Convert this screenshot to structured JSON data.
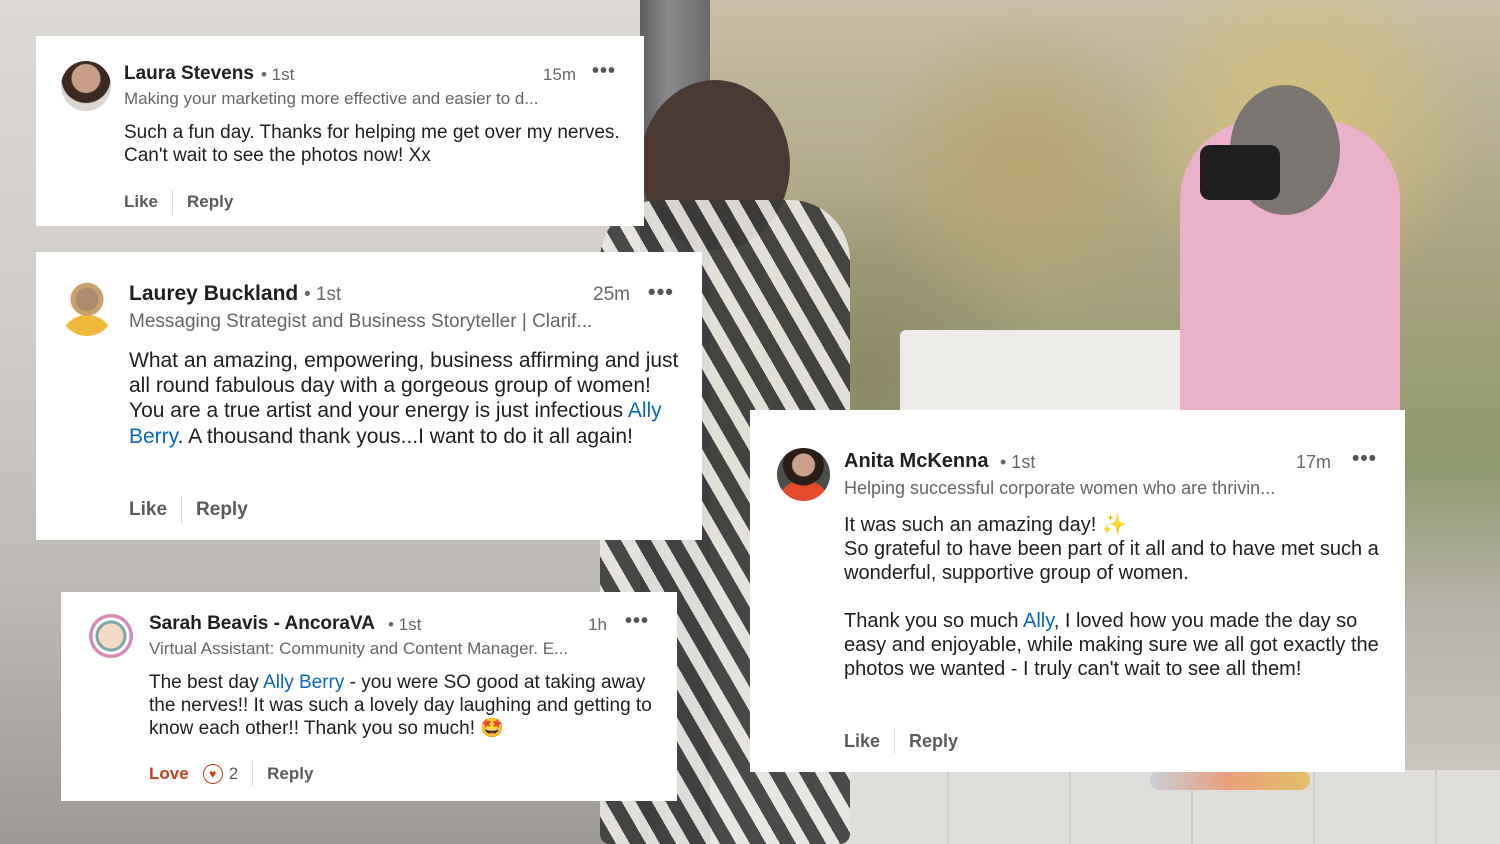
{
  "comments": [
    {
      "name": "Laura Stevens",
      "degree": "• 1st",
      "time": "15m",
      "more": "•••",
      "headline": "Making your marketing more effective and easier to d...",
      "body_parts": [
        "Such a fun day. Thanks for helping me get over my nerves. Can't wait to see the photos now! Xx"
      ],
      "like_label": "Like",
      "reply_label": "Reply"
    },
    {
      "name": "Laurey Buckland",
      "degree": "• 1st",
      "time": "25m",
      "more": "•••",
      "headline": "Messaging Strategist and Business Storyteller | Clarif...",
      "body_before": "What an amazing, empowering, business affirming and just all round fabulous day with a gorgeous group of women! You are a true artist and your energy is just infectious ",
      "mention": "Ally Berry",
      "body_after": ". A thousand thank yous...I want to do it all again!",
      "like_label": "Like",
      "reply_label": "Reply"
    },
    {
      "name": "Sarah Beavis - AncoraVA",
      "degree": "• 1st",
      "time": "1h",
      "more": "•••",
      "headline": "Virtual Assistant: Community and Content Manager. E...",
      "body_before": "The best day ",
      "mention": "Ally Berry",
      "body_after": " - you were SO good at taking away the nerves!! It was such a lovely day laughing and getting to know each other!! Thank you so much! ",
      "emoji": "🤩",
      "reaction_label": "Love",
      "reaction_icon": "heart-icon",
      "reaction_count": "2",
      "reply_label": "Reply",
      "colors": {
        "love": "#c4401c"
      }
    },
    {
      "name": "Anita McKenna",
      "degree": "• 1st",
      "time": "17m",
      "more": "•••",
      "headline": "Helping successful corporate women who are thrivin...",
      "line1": "It was such an amazing day! ",
      "sparkle": "✨",
      "line2": "So grateful to have been part of it all and to have met such a wonderful, supportive group of women.",
      "p2_before": "Thank you so much ",
      "mention": "Ally",
      "p2_after": ", I loved how you made the day so easy and enjoyable, while making sure we all got exactly the photos we wanted - I truly can't wait to see all them!",
      "like_label": "Like",
      "reply_label": "Reply"
    }
  ],
  "colors": {
    "mention": "#0a66c2",
    "card": "#ffffff"
  }
}
